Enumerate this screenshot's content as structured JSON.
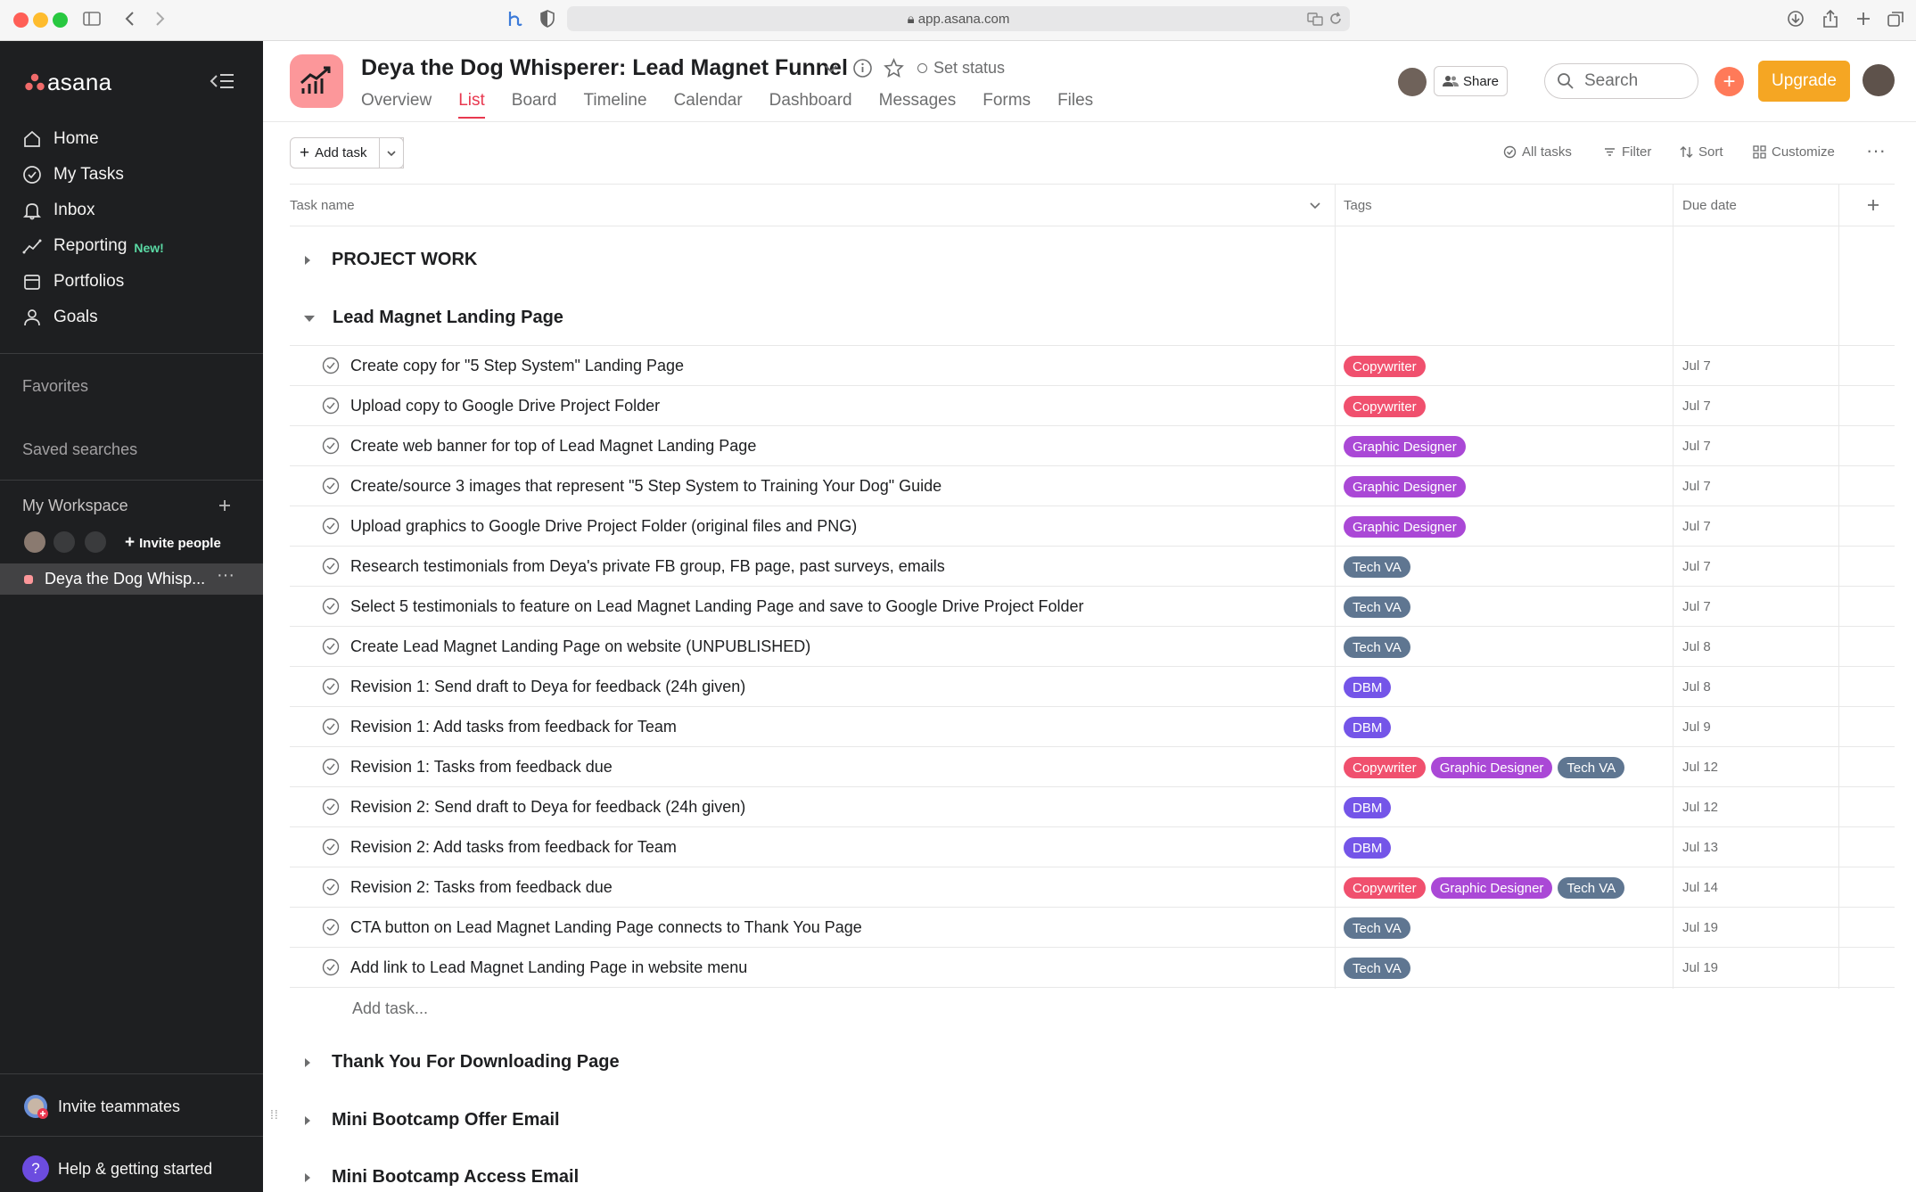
{
  "browser": {
    "url": "app.asana.com",
    "colors": {
      "close": "#ff5f57",
      "minimize": "#febc2e",
      "zoom": "#28c840"
    }
  },
  "sidebar": {
    "logo": "asana",
    "nav": [
      {
        "label": "Home",
        "icon": "home-icon"
      },
      {
        "label": "My Tasks",
        "icon": "check-circle-icon"
      },
      {
        "label": "Inbox",
        "icon": "bell-icon"
      },
      {
        "label": "Reporting",
        "icon": "trend-line-icon",
        "badge": "New!"
      },
      {
        "label": "Portfolios",
        "icon": "portfolio-icon"
      },
      {
        "label": "Goals",
        "icon": "person-icon"
      }
    ],
    "favorites": "Favorites",
    "saved_searches": "Saved searches",
    "workspace": "My Workspace",
    "invite_people": "Invite people",
    "project": "Deya the Dog Whisp...",
    "invite_teammates": "Invite teammates",
    "help": "Help & getting started"
  },
  "header": {
    "title": "Deya the Dog Whisperer: Lead Magnet Funnel",
    "set_status": "Set status",
    "tabs": [
      "Overview",
      "List",
      "Board",
      "Timeline",
      "Calendar",
      "Dashboard",
      "Messages",
      "Forms",
      "Files"
    ],
    "active_tab": "List",
    "share": "Share",
    "search_placeholder": "Search",
    "upgrade": "Upgrade"
  },
  "toolbar": {
    "add_task": "Add task",
    "all_tasks": "All tasks",
    "filter": "Filter",
    "sort": "Sort",
    "customize": "Customize"
  },
  "columns": {
    "task_name": "Task name",
    "tags": "Tags",
    "due_date": "Due date"
  },
  "sections": {
    "project_work": "PROJECT WORK",
    "lead_magnet": "Lead Magnet Landing Page",
    "thank_you": "Thank You For Downloading Page",
    "mini_offer": "Mini Bootcamp Offer Email",
    "mini_access": "Mini Bootcamp Access Email"
  },
  "tag_colors": {
    "Copywriter": "#f0506e",
    "Graphic Designer": "#aa48d6",
    "Tech VA": "#5f7691",
    "DBM": "#7455e8"
  },
  "tasks": [
    {
      "name": "Create copy for \"5 Step System\" Landing Page",
      "tags": [
        "Copywriter"
      ],
      "due": "Jul 7"
    },
    {
      "name": "Upload copy to Google Drive Project Folder",
      "tags": [
        "Copywriter"
      ],
      "due": "Jul 7"
    },
    {
      "name": "Create web banner for top of Lead Magnet Landing Page",
      "tags": [
        "Graphic Designer"
      ],
      "due": "Jul 7"
    },
    {
      "name": "Create/source 3 images that represent \"5 Step System to Training Your Dog\" Guide",
      "tags": [
        "Graphic Designer"
      ],
      "due": "Jul 7"
    },
    {
      "name": "Upload graphics to Google Drive Project Folder (original files and PNG)",
      "tags": [
        "Graphic Designer"
      ],
      "due": "Jul 7"
    },
    {
      "name": "Research testimonials from Deya's private FB group, FB page, past surveys, emails",
      "tags": [
        "Tech VA"
      ],
      "due": "Jul 7"
    },
    {
      "name": "Select 5 testimonials to feature on Lead Magnet Landing Page and save to Google Drive Project Folder",
      "tags": [
        "Tech VA"
      ],
      "due": "Jul 7"
    },
    {
      "name": "Create Lead Magnet Landing Page on website (UNPUBLISHED)",
      "tags": [
        "Tech VA"
      ],
      "due": "Jul 8"
    },
    {
      "name": "Revision 1: Send draft to Deya for feedback (24h given)",
      "tags": [
        "DBM"
      ],
      "due": "Jul 8"
    },
    {
      "name": "Revision 1: Add tasks from feedback for Team",
      "tags": [
        "DBM"
      ],
      "due": "Jul 9"
    },
    {
      "name": "Revision 1: Tasks from feedback due",
      "tags": [
        "Copywriter",
        "Graphic Designer",
        "Tech VA"
      ],
      "due": "Jul 12"
    },
    {
      "name": "Revision 2: Send draft to Deya for feedback (24h given)",
      "tags": [
        "DBM"
      ],
      "due": "Jul 12"
    },
    {
      "name": "Revision 2: Add tasks from feedback for Team",
      "tags": [
        "DBM"
      ],
      "due": "Jul 13"
    },
    {
      "name": "Revision 2: Tasks from feedback due",
      "tags": [
        "Copywriter",
        "Graphic Designer",
        "Tech VA"
      ],
      "due": "Jul 14"
    },
    {
      "name": "CTA button on Lead Magnet Landing Page connects to Thank You Page",
      "tags": [
        "Tech VA"
      ],
      "due": "Jul 19"
    },
    {
      "name": "Add link to Lead Magnet Landing Page in website menu",
      "tags": [
        "Tech VA"
      ],
      "due": "Jul 19"
    }
  ],
  "add_task_inline": "Add task..."
}
